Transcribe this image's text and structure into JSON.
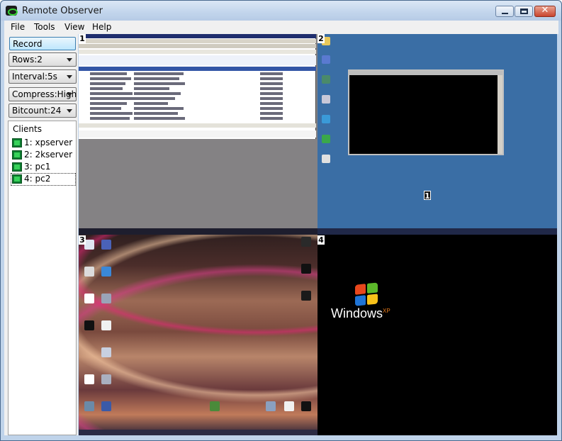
{
  "window": {
    "title": "Remote Observer",
    "controls": {
      "minimize": "",
      "maximize": "",
      "close": "✕"
    }
  },
  "menu": [
    "File",
    "Tools",
    "View",
    "Help"
  ],
  "sidebar": {
    "record_label": "Record",
    "rows": "Rows:2",
    "interval": "Interval:5s",
    "compress": "Compress:High",
    "bitcount": "Bitcount:24",
    "clients_label": "Clients",
    "clients": [
      {
        "label": "1: xpserver",
        "selected": false
      },
      {
        "label": "2: 2kserver",
        "selected": false
      },
      {
        "label": "3: pc1",
        "selected": false
      },
      {
        "label": "4: pc2",
        "selected": true
      }
    ]
  },
  "screens": [
    {
      "number": "1"
    },
    {
      "number": "2",
      "badge": "1"
    },
    {
      "number": "3"
    },
    {
      "number": "4",
      "brand": "Windows",
      "brand_sup": "XP"
    }
  ],
  "colors": {
    "desktop_blue": "#3a6ea5",
    "client_icon": "#38d25a"
  }
}
